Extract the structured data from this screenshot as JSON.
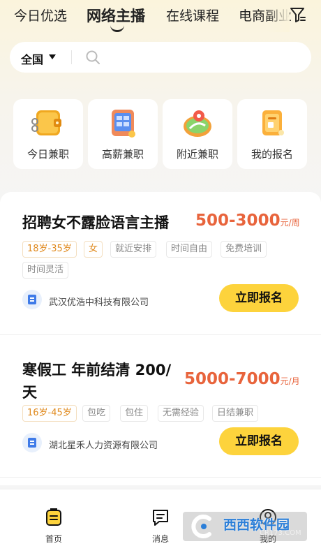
{
  "tabs": [
    "今日优选",
    "网络主播",
    "在线课程",
    "电商副业"
  ],
  "active_tab": 1,
  "search": {
    "region": "全国"
  },
  "categories": [
    "今日兼职",
    "高薪兼职",
    "附近兼职",
    "我的报名"
  ],
  "jobs": [
    {
      "title_lines": [
        "招聘女不露脸语言主播"
      ],
      "salary": "500-3000",
      "salary_unit": "元/周",
      "tags_row1": [
        "18岁-35岁",
        "女",
        "就近安排",
        "时间自由",
        "免费培训"
      ],
      "tags_row2": [
        "时间灵活"
      ],
      "company": "武汉优浩中科技有限公司",
      "apply_label": "立即报名"
    },
    {
      "title_lines": [
        "寒假工 年前结清 200/",
        "天"
      ],
      "salary": "5000-7000",
      "salary_unit": "元/月",
      "tags_row1": [
        "16岁-45岁",
        "包吃",
        "包住",
        "无需经验",
        "日结兼职"
      ],
      "tags_row2": [],
      "company": "湖北星禾人力资源有限公司",
      "apply_label": "立即报名"
    }
  ],
  "nav": [
    "首页",
    "消息",
    "我的"
  ],
  "watermark": {
    "main": "西西软件园",
    "sub": "CR173.COM"
  },
  "colors": {
    "accent": "#fdd33c",
    "salary": "#e8643c",
    "tag_highlight": "#e08a1e"
  }
}
